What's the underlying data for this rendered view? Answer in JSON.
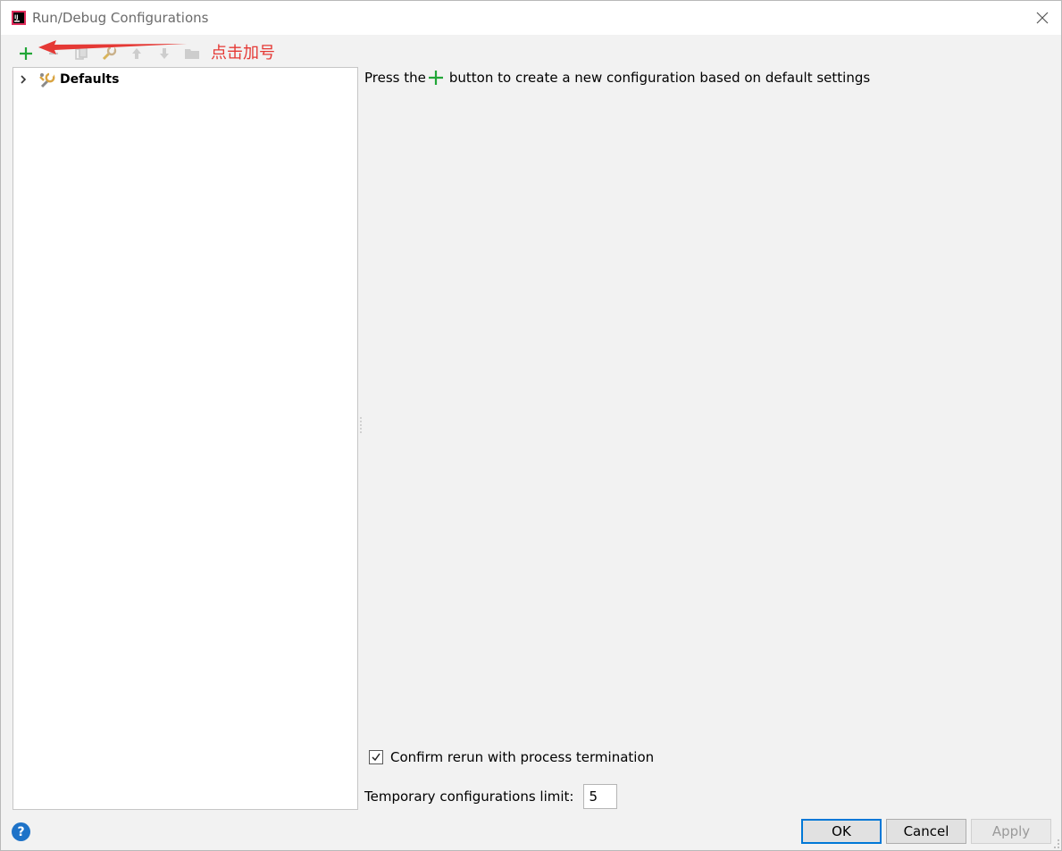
{
  "window": {
    "title": "Run/Debug Configurations"
  },
  "toolbar": {
    "icons": [
      "add-icon",
      "remove-icon",
      "copy-icon",
      "edit-defaults-icon",
      "move-up-icon",
      "move-down-icon",
      "folder-icon"
    ]
  },
  "annotation": {
    "text": "点击加号",
    "color": "#e53935"
  },
  "tree": {
    "items": [
      {
        "label": "Defaults",
        "expanded": false,
        "icon": "wrench-icon"
      }
    ]
  },
  "hint": {
    "prefix": "Press the",
    "suffix": "button to create a new configuration based on default settings"
  },
  "options": {
    "confirm_rerun_label": "Confirm rerun with process termination",
    "confirm_rerun_checked": true,
    "temp_limit_label": "Temporary configurations limit:",
    "temp_limit_value": "5"
  },
  "buttons": {
    "help": "?",
    "ok": "OK",
    "cancel": "Cancel",
    "apply": "Apply"
  },
  "colors": {
    "accent": "#0078d7",
    "plus_green": "#21a637"
  }
}
